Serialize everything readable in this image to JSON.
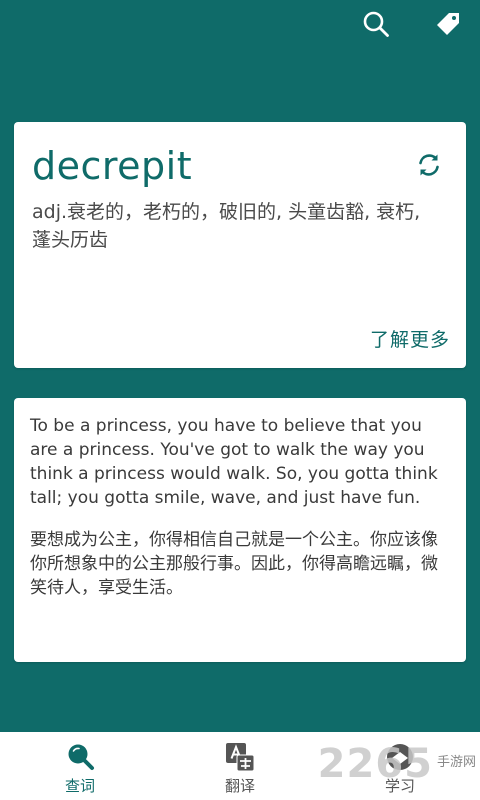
{
  "header": {
    "search_icon": "search-icon",
    "tag_icon": "tag-icon"
  },
  "word_card": {
    "word": "decrepit",
    "definition": "adj.衰老的，老朽的，破旧的, 头童齿豁, 衰朽, 蓬头历齿",
    "refresh_icon": "refresh-icon",
    "more_label": "了解更多"
  },
  "quote_card": {
    "english": "To be a princess, you have to believe that you are a princess. You've got to walk the way you think a princess would walk. So, you gotta think tall; you gotta smile, wave, and just have fun.",
    "chinese": "要想成为公主，你得相信自己就是一个公主。你应该像你所想象中的公主那般行事。因此，你得高瞻远瞩，微笑待人，享受生活。"
  },
  "bottom_nav": {
    "tabs": [
      {
        "label": "查词",
        "icon": "magnifier-icon",
        "active": true
      },
      {
        "label": "翻译",
        "icon": "translate-icon",
        "active": false
      },
      {
        "label": "学习",
        "icon": "study-icon",
        "active": false
      }
    ]
  },
  "watermark": {
    "number": "2265",
    "site": "手游网"
  },
  "colors": {
    "primary": "#0f6b69",
    "card": "#ffffff"
  }
}
